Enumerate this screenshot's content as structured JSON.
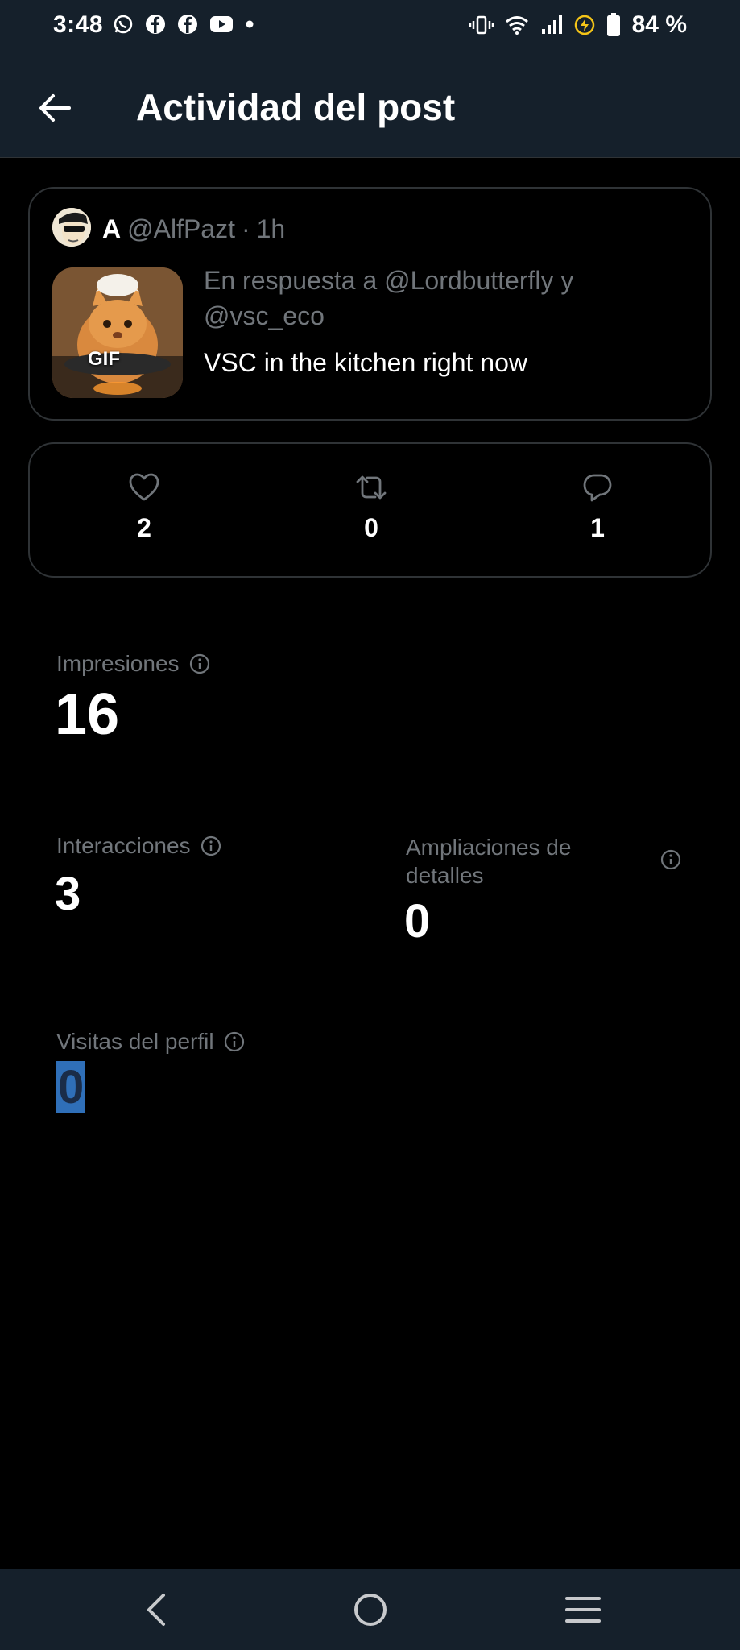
{
  "status_bar": {
    "time": "3:48",
    "battery_percent": "84 %",
    "left_icons": [
      "whatsapp-icon",
      "facebook-icon",
      "facebook-icon",
      "youtube-icon",
      "dot-icon"
    ],
    "right_icons": [
      "vibrate-icon",
      "wifi-icon",
      "signal-icon",
      "charging-icon",
      "battery-icon"
    ]
  },
  "header": {
    "title": "Actividad del post",
    "back_icon": "arrow-left-icon"
  },
  "post": {
    "author_name": "A",
    "author_handle": "@AlfPazt",
    "separator": "·",
    "time": "1h",
    "reply_to": "En respuesta a @Lordbutterfly y @vsc_eco",
    "text": "VSC in the kitchen right now",
    "media_badge": "GIF"
  },
  "engagement": {
    "likes": "2",
    "reposts": "0",
    "replies": "1"
  },
  "metrics": {
    "impressions_label": "Impresiones",
    "impressions_value": "16",
    "interactions_label": "Interacciones",
    "interactions_value": "3",
    "detail_expands_label": "Ampliaciones de detalles",
    "detail_expands_value": "0",
    "profile_visits_label": "Visitas del perfil",
    "profile_visits_value": "0"
  },
  "colors": {
    "bar_background": "#15202b",
    "background": "#000000",
    "border": "#2f3336",
    "muted_text": "#71767b",
    "selection": "#2f6fb8",
    "charging": "#f5c518"
  }
}
